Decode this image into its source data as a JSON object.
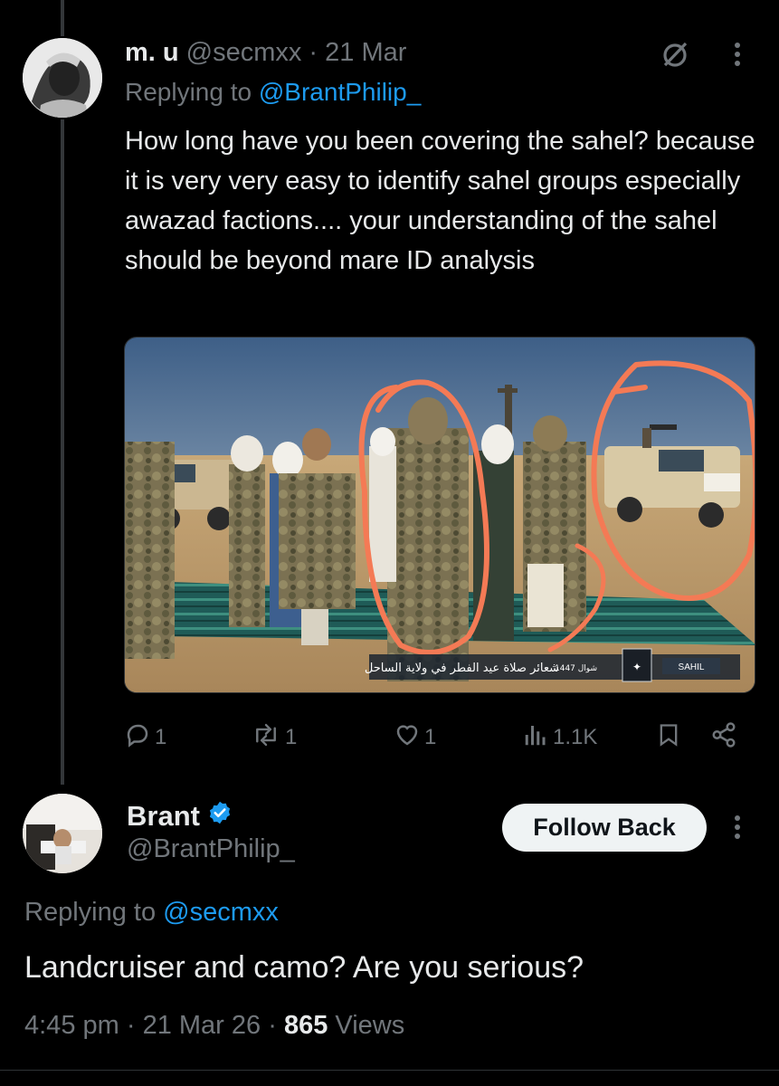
{
  "reply_tweet": {
    "display_name": "m. u",
    "handle": "@secmxx",
    "separator": "·",
    "date": "21 Mar",
    "replying_prefix": "Replying to ",
    "replying_to": "@BrantPhilip_",
    "text": "How long have you been covering the sahel? because it is very very easy to identify sahel groups especially awazad factions.... your understanding of  the sahel should be beyond mare ID analysis",
    "media": {
      "overlay_caption": "شعائر صلاة عيد الفطر في ولاية الساحل",
      "overlay_date": "شوال 1447",
      "overlay_region": "SAHIL"
    },
    "actions": {
      "replies": "1",
      "reposts": "1",
      "likes": "1",
      "views": "1.1K"
    }
  },
  "main_tweet": {
    "display_name": "Brant",
    "handle": "@BrantPhilip_",
    "follow_label": "Follow Back",
    "replying_prefix": "Replying to ",
    "replying_to": "@secmxx",
    "text": "Landcruiser and camo? Are you serious?",
    "time": "4:45 pm",
    "separator1": " · ",
    "date": "21 Mar 26",
    "separator2": " · ",
    "views_count": "865",
    "views_label": " Views"
  },
  "colors": {
    "background": "#000000",
    "text": "#e7e9ea",
    "muted": "#71767b",
    "link": "#1d9bf0",
    "verified": "#1d9bf0",
    "circle_annotation": "#f47a55"
  },
  "icons": [
    "grok-slash-icon",
    "more-icon",
    "reply-icon",
    "repost-icon",
    "like-icon",
    "views-icon",
    "bookmark-icon",
    "share-icon",
    "verified-icon"
  ]
}
